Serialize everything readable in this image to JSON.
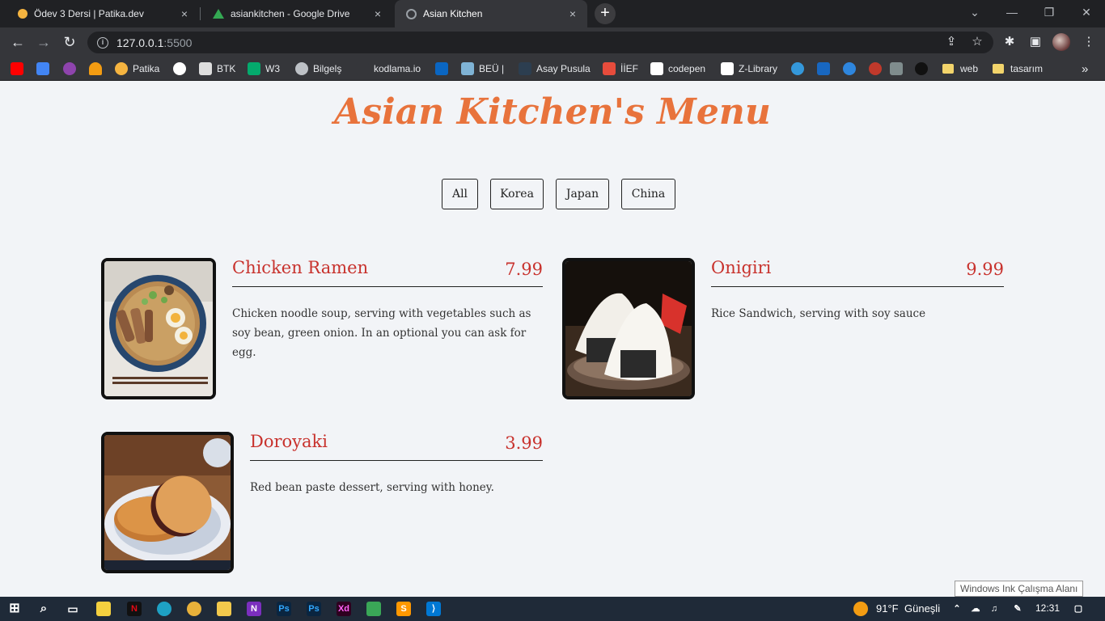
{
  "browser": {
    "tabs": [
      {
        "title": "Ödev 3 Dersi | Patika.dev",
        "close": "×"
      },
      {
        "title": "asiankitchen - Google Drive",
        "close": "×"
      },
      {
        "title": "Asian Kitchen",
        "close": "×"
      }
    ],
    "new_tab": "+",
    "window_controls": {
      "minimize": "—",
      "restore": "❐",
      "close": "✕"
    },
    "nav": {
      "back": "←",
      "forward": "→",
      "reload": "↻"
    },
    "url_host": "127.0.0.1",
    "url_port": ":5500",
    "toolbar_icons": {
      "share": "⇪",
      "star": "☆",
      "extensions": "✱",
      "sidepanel": "▣",
      "menu": "⋮"
    },
    "bookmarks": [
      {
        "label": "",
        "icon": "youtube-icon",
        "color": "#ff0000"
      },
      {
        "label": "",
        "icon": "translate-icon",
        "color": "#4285f4"
      },
      {
        "label": "",
        "icon": "u-icon",
        "color": "#8e44ad"
      },
      {
        "label": "",
        "icon": "rocket-icon",
        "color": "#f39c12"
      },
      {
        "label": "Patika",
        "icon": "patika-icon",
        "color": "#f5b440"
      },
      {
        "label": "",
        "icon": "github-icon",
        "color": "#ffffff"
      },
      {
        "label": "BTK",
        "icon": "btk-icon",
        "color": "#dddddd"
      },
      {
        "label": "W3",
        "icon": "w3-icon",
        "color": "#04aa6d"
      },
      {
        "label": "Bilgelş",
        "icon": "globe-icon",
        "color": "#bdc1c6"
      },
      {
        "label": "kodlama.io",
        "icon": "blank-icon",
        "color": "#35363a"
      },
      {
        "label": "",
        "icon": "linkedin-icon",
        "color": "#0a66c2"
      },
      {
        "label": "BEÜ |",
        "icon": "beu-icon",
        "color": "#7fb3d5"
      },
      {
        "label": "Asay Pusula",
        "icon": "asay-icon",
        "color": "#2c3e50"
      },
      {
        "label": "İİEF",
        "icon": "calendar-icon",
        "color": "#e74c3c"
      },
      {
        "label": "codepen",
        "icon": "codepen-icon",
        "color": "#ffffff"
      },
      {
        "label": "Z-Library",
        "icon": "zlib-icon",
        "color": "#ffffff"
      },
      {
        "label": "",
        "icon": "c-icon",
        "color": "#3498db"
      },
      {
        "label": "",
        "icon": "vuetify-icon",
        "color": "#1867c0"
      },
      {
        "label": "",
        "icon": "bot-icon",
        "color": "#2e86de"
      },
      {
        "label": "",
        "icon": "badge-160-icon",
        "color": "#c0392b"
      },
      {
        "label": "",
        "icon": "cap-icon",
        "color": "#7f8c8d"
      },
      {
        "label": "",
        "icon": "dark-icon",
        "color": "#111111"
      },
      {
        "label": "web",
        "icon": "folder-icon",
        "color": "#f2d46b"
      },
      {
        "label": "tasarım",
        "icon": "folder-icon",
        "color": "#f2d46b"
      }
    ],
    "bookmarks_overflow": "»"
  },
  "page": {
    "title": "Asian Kitchen's Menu",
    "filters": [
      "All",
      "Korea",
      "Japan",
      "China"
    ],
    "items": [
      {
        "name": "Chicken Ramen",
        "price": "7.99",
        "desc": "Chicken noodle soup, serving with vegetables such as soy bean, green onion. In an optional you can ask for egg."
      },
      {
        "name": "Onigiri",
        "price": "9.99",
        "desc": "Rice Sandwich, serving with soy sauce"
      },
      {
        "name": "Doroyaki",
        "price": "3.99",
        "desc": "Red bean paste dessert, serving with honey."
      }
    ]
  },
  "tooltip": "Windows Ink Çalışma Alanı",
  "taskbar": {
    "weather": "91°F",
    "weather_label": "Güneşli",
    "time": "12:31"
  }
}
